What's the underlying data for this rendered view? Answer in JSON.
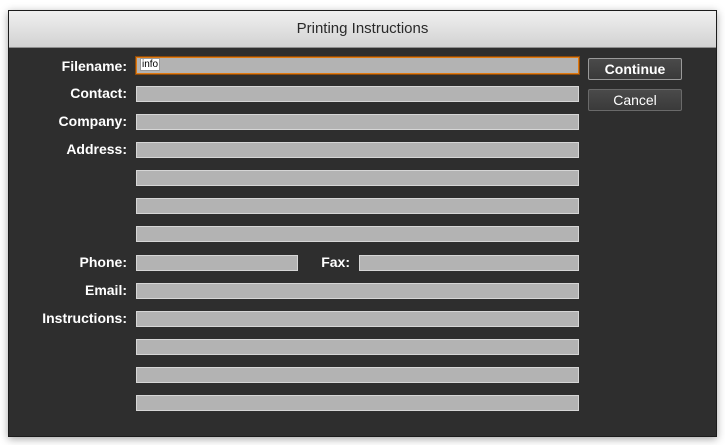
{
  "window": {
    "title": "Printing Instructions"
  },
  "labels": {
    "filename": "Filename:",
    "contact": "Contact:",
    "company": "Company:",
    "address": "Address:",
    "phone": "Phone:",
    "fax": "Fax:",
    "email": "Email:",
    "instructions": "Instructions:"
  },
  "fields": {
    "filename": "info",
    "contact": "",
    "company": "",
    "address_1": "",
    "address_2": "",
    "address_3": "",
    "address_4": "",
    "phone": "",
    "fax": "",
    "email": "",
    "instructions_1": "",
    "instructions_2": "",
    "instructions_3": "",
    "instructions_4": ""
  },
  "buttons": {
    "continue": "Continue",
    "cancel": "Cancel"
  },
  "colors": {
    "focus_ring": "#e07a12",
    "dialog_bg": "#2e2e2e",
    "field_bg": "#b3b3b3"
  }
}
